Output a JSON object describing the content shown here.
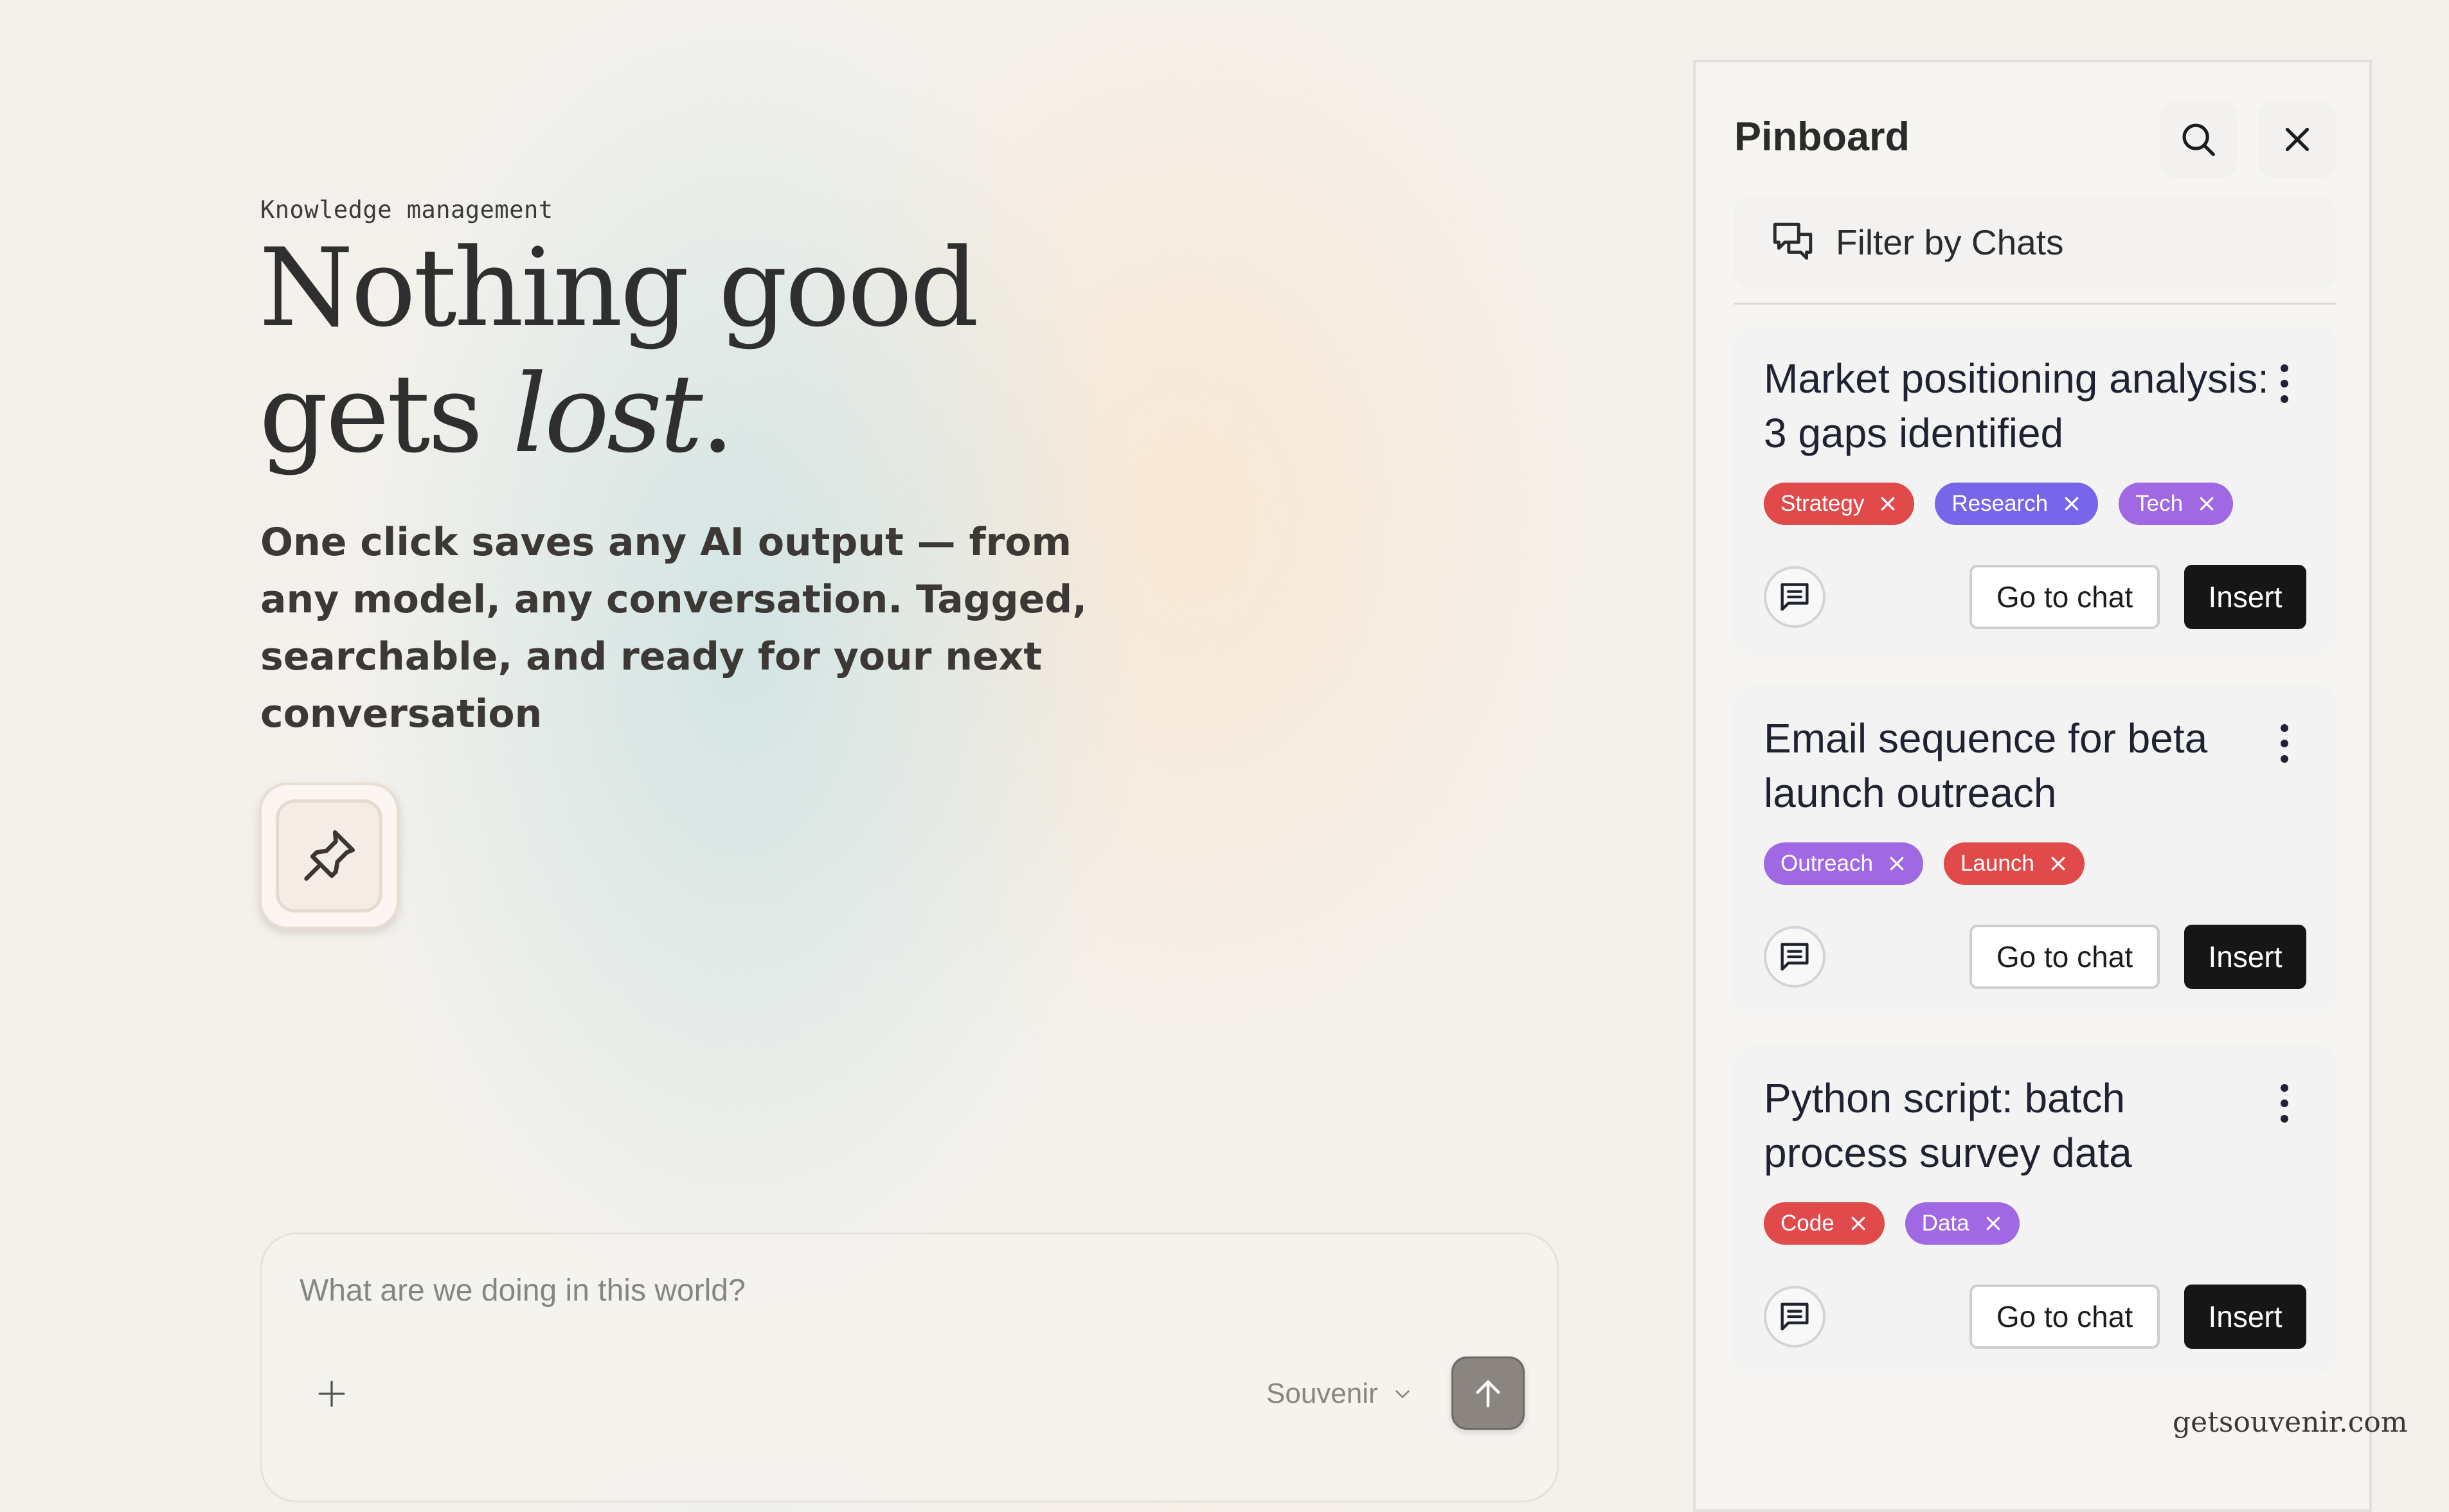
{
  "hero": {
    "eyebrow": "Knowledge management",
    "headline_line1": "Nothing good",
    "headline_line2_plain": "gets ",
    "headline_line2_italic": "lost",
    "headline_line2_end": ".",
    "subcopy": "One click saves any AI output — from any model, any conversation. Tagged, searchable, and ready for your next conversation",
    "pin_icon": "pushpin-icon"
  },
  "composer": {
    "placeholder": "What are we doing in this world?",
    "model_label": "Souvenir",
    "plus_icon": "plus-icon",
    "send_icon": "arrow-up-icon"
  },
  "pinboard": {
    "title": "Pinboard",
    "search_icon": "search-icon",
    "close_icon": "close-icon",
    "filter_label": "Filter by Chats",
    "cards": [
      {
        "title_line1": "Market positioning analysis:",
        "title_line2": "3 gaps identified",
        "tags": [
          {
            "label": "Strategy",
            "color": "#e14a4a"
          },
          {
            "label": "Research",
            "color": "#7866ea"
          },
          {
            "label": "Tech",
            "color": "#a068e2"
          }
        ],
        "goto_label": "Go to chat",
        "insert_label": "Insert"
      },
      {
        "title_line1": "Email sequence for beta",
        "title_line2": "launch outreach",
        "tags": [
          {
            "label": "Outreach",
            "color": "#a068e2"
          },
          {
            "label": "Launch",
            "color": "#e14a4a"
          }
        ],
        "goto_label": "Go to chat",
        "insert_label": "Insert"
      },
      {
        "title_line1": "Python script: batch",
        "title_line2": "process survey data",
        "tags": [
          {
            "label": "Code",
            "color": "#e14a4a"
          },
          {
            "label": "Data",
            "color": "#a068e2"
          }
        ],
        "goto_label": "Go to chat",
        "insert_label": "Insert"
      }
    ]
  },
  "watermark": "getsouvenir.com"
}
